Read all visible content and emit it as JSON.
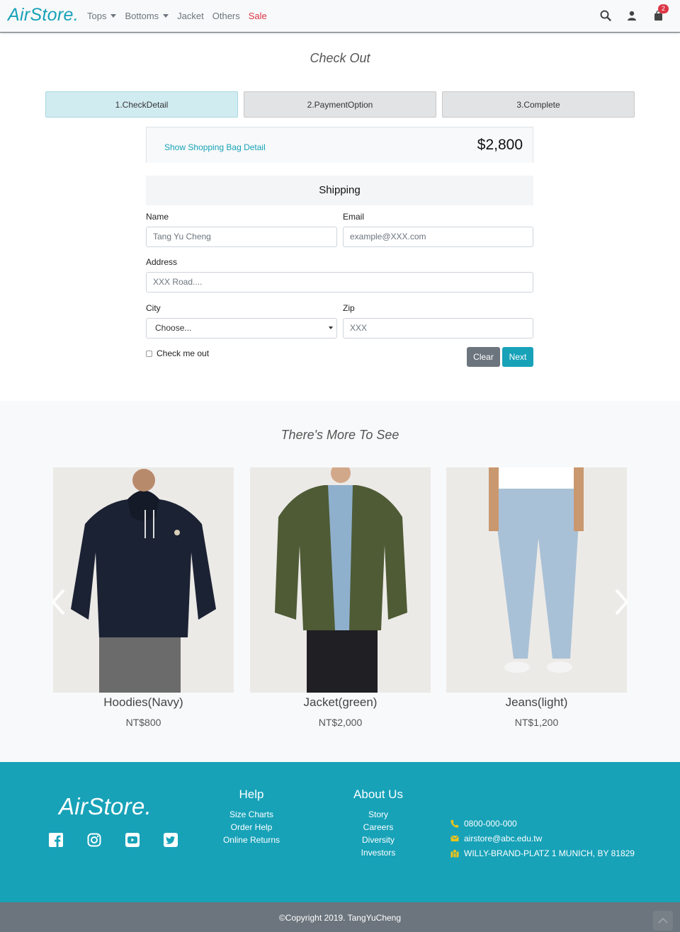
{
  "nav": {
    "brand": "AirStore.",
    "links": [
      "Tops",
      "Bottoms",
      "Jacket",
      "Others",
      "Sale"
    ],
    "cart_count": "2"
  },
  "checkout": {
    "title": "Check Out",
    "steps": [
      "1.CheckDetail",
      "2.PaymentOption",
      "3.Complete"
    ],
    "active_step": 0,
    "bag_link": "Show Shopping Bag Detail",
    "total": "$2,800",
    "shipping_heading": "Shipping",
    "name_label": "Name",
    "name_placeholder": "Tang Yu Cheng",
    "email_label": "Email",
    "email_placeholder": "example@XXX.com",
    "address_label": "Address",
    "address_placeholder": "XXX Road....",
    "city_label": "City",
    "city_value": "Choose...",
    "zip_label": "Zip",
    "zip_placeholder": "XXX",
    "check_label": "Check me out",
    "clear_label": "Clear",
    "next_label": "Next"
  },
  "more": {
    "title": "There's More To See",
    "products": [
      {
        "name": "Hoodies(Navy)",
        "price": "NT$800"
      },
      {
        "name": "Jacket(green)",
        "price": "NT$2,000"
      },
      {
        "name": "Jeans(light)",
        "price": "NT$1,200"
      }
    ]
  },
  "footer": {
    "brand": "AirStore.",
    "help_title": "Help",
    "help_items": [
      "Size Charts",
      "Order Help",
      "Online Returns"
    ],
    "about_title": "About Us",
    "about_items": [
      "Story",
      "Careers",
      "Diversity",
      "Investors"
    ],
    "phone": "0800-000-000",
    "email": "airstore@abc.edu.tw",
    "address": "WILLY-BRAND-PLATZ 1 MUNICH, BY 81829",
    "copyright": "©Copyright 2019. TangYuCheng"
  },
  "colors": {
    "accent": "#17a2b8",
    "sale": "#dc3545",
    "secondary": "#6c757d",
    "icon_yellow": "#f0c419"
  }
}
